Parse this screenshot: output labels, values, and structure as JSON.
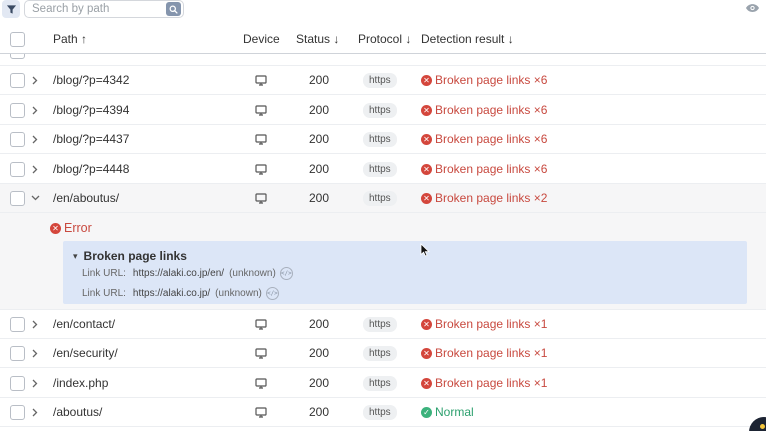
{
  "toolbar": {
    "search_placeholder": "Search by path"
  },
  "columns": {
    "path": "Path ↑",
    "device": "Device",
    "status": "Status ↓",
    "protocol": "Protocol ↓",
    "result": "Detection result ↓"
  },
  "rows": [
    {
      "path": "/blog/?p=4342",
      "status": "200",
      "protocol": "https",
      "result": "Broken page links ×6",
      "kind": "error",
      "expanded": false
    },
    {
      "path": "/blog/?p=4394",
      "status": "200",
      "protocol": "https",
      "result": "Broken page links ×6",
      "kind": "error",
      "expanded": false
    },
    {
      "path": "/blog/?p=4437",
      "status": "200",
      "protocol": "https",
      "result": "Broken page links ×6",
      "kind": "error",
      "expanded": false
    },
    {
      "path": "/blog/?p=4448",
      "status": "200",
      "protocol": "https",
      "result": "Broken page links ×6",
      "kind": "error",
      "expanded": false
    },
    {
      "path": "/en/aboutus/",
      "status": "200",
      "protocol": "https",
      "result": "Broken page links ×2",
      "kind": "error",
      "expanded": true
    },
    {
      "path": "/en/contact/",
      "status": "200",
      "protocol": "https",
      "result": "Broken page links ×1",
      "kind": "error",
      "expanded": false
    },
    {
      "path": "/en/security/",
      "status": "200",
      "protocol": "https",
      "result": "Broken page links ×1",
      "kind": "error",
      "expanded": false
    },
    {
      "path": "/index.php",
      "status": "200",
      "protocol": "https",
      "result": "Broken page links ×1",
      "kind": "error",
      "expanded": false
    },
    {
      "path": "/aboutus/",
      "status": "200",
      "protocol": "https",
      "result": "Normal",
      "kind": "ok",
      "expanded": false
    }
  ],
  "detail": {
    "error_label": "Error",
    "group_title": "Broken page links",
    "links": [
      {
        "label": "Link URL:",
        "url": "https://alaki.co.jp/en/",
        "state": "(unknown)"
      },
      {
        "label": "Link URL:",
        "url": "https://alaki.co.jp/",
        "state": "(unknown)"
      }
    ]
  },
  "colors": {
    "error": "#c8493f",
    "ok": "#2ca06e",
    "highlight": "#dce6f7",
    "filter_bg": "#e2e8f3",
    "search_btn": "#8595ad"
  },
  "icons": {
    "filter": "filter-icon",
    "search": "search-icon",
    "visibility": "eye-icon",
    "device": "desktop-icon",
    "error": "error-x-icon",
    "ok": "check-icon",
    "expand": "chevron-right-icon",
    "collapse": "chevron-down-icon",
    "source": "code-icon"
  }
}
